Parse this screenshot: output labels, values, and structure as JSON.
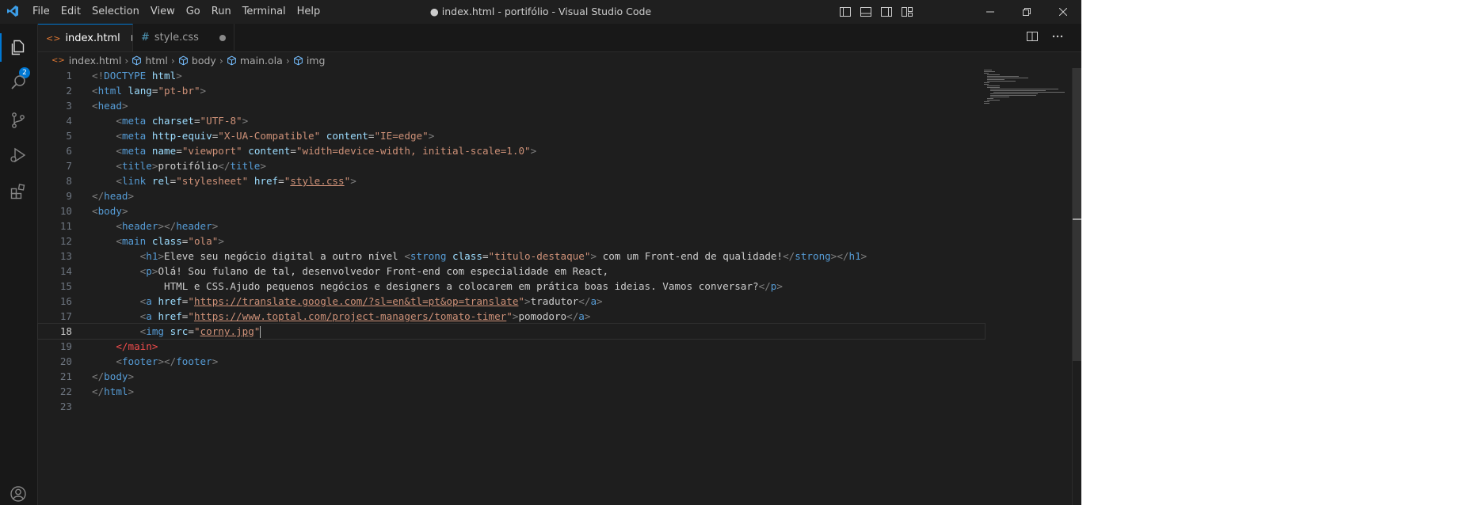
{
  "window": {
    "title": "● index.html - portifólio - Visual Studio Code"
  },
  "menu": [
    "File",
    "Edit",
    "Selection",
    "View",
    "Go",
    "Run",
    "Terminal",
    "Help"
  ],
  "activity": {
    "explorer_badge": "2"
  },
  "tabs": [
    {
      "label": "index.html",
      "icon": "html-file-icon",
      "modified": true
    },
    {
      "label": "style.css",
      "icon": "css-file-icon",
      "icon_glyph": "#",
      "modified": true
    }
  ],
  "breadcrumb": [
    "index.html",
    "html",
    "body",
    "main.ola",
    "img"
  ],
  "editor": {
    "current_line": 18,
    "lines": [
      {
        "n": "1",
        "tokens": [
          [
            "br",
            "<!"
          ],
          [
            "tag",
            "DOCTYPE"
          ],
          [
            "txt",
            " "
          ],
          [
            "attr",
            "html"
          ],
          [
            "br",
            ">"
          ]
        ]
      },
      {
        "n": "2",
        "tokens": [
          [
            "br",
            "<"
          ],
          [
            "tag",
            "html"
          ],
          [
            "txt",
            " "
          ],
          [
            "attr",
            "lang"
          ],
          [
            "txt",
            "="
          ],
          [
            "str",
            "\"pt-br\""
          ],
          [
            "br",
            ">"
          ]
        ]
      },
      {
        "n": "3",
        "tokens": [
          [
            "br",
            "<"
          ],
          [
            "tag",
            "head"
          ],
          [
            "br",
            ">"
          ]
        ]
      },
      {
        "n": "4",
        "tokens": [
          [
            "txt",
            "    "
          ],
          [
            "br",
            "<"
          ],
          [
            "tag",
            "meta"
          ],
          [
            "txt",
            " "
          ],
          [
            "attr",
            "charset"
          ],
          [
            "txt",
            "="
          ],
          [
            "str",
            "\"UTF-8\""
          ],
          [
            "br",
            ">"
          ]
        ]
      },
      {
        "n": "5",
        "tokens": [
          [
            "txt",
            "    "
          ],
          [
            "br",
            "<"
          ],
          [
            "tag",
            "meta"
          ],
          [
            "txt",
            " "
          ],
          [
            "attr",
            "http-equiv"
          ],
          [
            "txt",
            "="
          ],
          [
            "str",
            "\"X-UA-Compatible\""
          ],
          [
            "txt",
            " "
          ],
          [
            "attr",
            "content"
          ],
          [
            "txt",
            "="
          ],
          [
            "str",
            "\"IE=edge\""
          ],
          [
            "br",
            ">"
          ]
        ]
      },
      {
        "n": "6",
        "tokens": [
          [
            "txt",
            "    "
          ],
          [
            "br",
            "<"
          ],
          [
            "tag",
            "meta"
          ],
          [
            "txt",
            " "
          ],
          [
            "attr",
            "name"
          ],
          [
            "txt",
            "="
          ],
          [
            "str",
            "\"viewport\""
          ],
          [
            "txt",
            " "
          ],
          [
            "attr",
            "content"
          ],
          [
            "txt",
            "="
          ],
          [
            "str",
            "\"width=device-width, initial-scale=1.0\""
          ],
          [
            "br",
            ">"
          ]
        ]
      },
      {
        "n": "7",
        "tokens": [
          [
            "txt",
            "    "
          ],
          [
            "br",
            "<"
          ],
          [
            "tag",
            "title"
          ],
          [
            "br",
            ">"
          ],
          [
            "txt",
            "protifólio"
          ],
          [
            "br",
            "</"
          ],
          [
            "tag",
            "title"
          ],
          [
            "br",
            ">"
          ]
        ]
      },
      {
        "n": "8",
        "tokens": [
          [
            "txt",
            "    "
          ],
          [
            "br",
            "<"
          ],
          [
            "tag",
            "link"
          ],
          [
            "txt",
            " "
          ],
          [
            "attr",
            "rel"
          ],
          [
            "txt",
            "="
          ],
          [
            "str",
            "\"stylesheet\""
          ],
          [
            "txt",
            " "
          ],
          [
            "attr",
            "href"
          ],
          [
            "txt",
            "="
          ],
          [
            "str",
            "\""
          ],
          [
            "stru",
            "style.css"
          ],
          [
            "str",
            "\""
          ],
          [
            "br",
            ">"
          ]
        ]
      },
      {
        "n": "9",
        "tokens": [
          [
            "br",
            "</"
          ],
          [
            "tag",
            "head"
          ],
          [
            "br",
            ">"
          ]
        ]
      },
      {
        "n": "10",
        "tokens": [
          [
            "br",
            "<"
          ],
          [
            "tag",
            "body"
          ],
          [
            "br",
            ">"
          ]
        ]
      },
      {
        "n": "11",
        "tokens": [
          [
            "txt",
            "    "
          ],
          [
            "br",
            "<"
          ],
          [
            "tag",
            "header"
          ],
          [
            "br",
            "></"
          ],
          [
            "tag",
            "header"
          ],
          [
            "br",
            ">"
          ]
        ]
      },
      {
        "n": "12",
        "tokens": [
          [
            "txt",
            "    "
          ],
          [
            "br",
            "<"
          ],
          [
            "tag",
            "main"
          ],
          [
            "txt",
            " "
          ],
          [
            "attr",
            "class"
          ],
          [
            "txt",
            "="
          ],
          [
            "str",
            "\"ola\""
          ],
          [
            "br",
            ">"
          ]
        ]
      },
      {
        "n": "13",
        "tokens": [
          [
            "txt",
            "        "
          ],
          [
            "br",
            "<"
          ],
          [
            "tag",
            "h1"
          ],
          [
            "br",
            ">"
          ],
          [
            "txt",
            "Eleve seu negócio digital a outro nível "
          ],
          [
            "br",
            "<"
          ],
          [
            "tag",
            "strong"
          ],
          [
            "txt",
            " "
          ],
          [
            "attr",
            "class"
          ],
          [
            "txt",
            "="
          ],
          [
            "str",
            "\"titulo-destaque\""
          ],
          [
            "br",
            ">"
          ],
          [
            "txt",
            " com um Front-end de qualidade!"
          ],
          [
            "br",
            "</"
          ],
          [
            "tag",
            "strong"
          ],
          [
            "br",
            "></"
          ],
          [
            "tag",
            "h1"
          ],
          [
            "br",
            ">"
          ]
        ]
      },
      {
        "n": "14",
        "tokens": [
          [
            "txt",
            "        "
          ],
          [
            "br",
            "<"
          ],
          [
            "tag",
            "p"
          ],
          [
            "br",
            ">"
          ],
          [
            "txt",
            "Olá! Sou fulano de tal, desenvolvedor Front-end com especialidade em React,"
          ]
        ]
      },
      {
        "n": "15",
        "tokens": [
          [
            "txt",
            "            HTML e CSS.Ajudo pequenos negócios e designers a colocarem em prática boas ideias. Vamos conversar?"
          ],
          [
            "br",
            "</"
          ],
          [
            "tag",
            "p"
          ],
          [
            "br",
            ">"
          ]
        ]
      },
      {
        "n": "16",
        "tokens": [
          [
            "txt",
            "        "
          ],
          [
            "br",
            "<"
          ],
          [
            "tag",
            "a"
          ],
          [
            "txt",
            " "
          ],
          [
            "attr",
            "href"
          ],
          [
            "txt",
            "="
          ],
          [
            "str",
            "\""
          ],
          [
            "stru",
            "https://translate.google.com/?sl=en&tl=pt&op=translate"
          ],
          [
            "str",
            "\""
          ],
          [
            "br",
            ">"
          ],
          [
            "txt",
            "tradutor"
          ],
          [
            "br",
            "</"
          ],
          [
            "tag",
            "a"
          ],
          [
            "br",
            ">"
          ]
        ]
      },
      {
        "n": "17",
        "tokens": [
          [
            "txt",
            "        "
          ],
          [
            "br",
            "<"
          ],
          [
            "tag",
            "a"
          ],
          [
            "txt",
            " "
          ],
          [
            "attr",
            "href"
          ],
          [
            "txt",
            "="
          ],
          [
            "str",
            "\""
          ],
          [
            "stru",
            "https://www.toptal.com/project-managers/tomato-timer"
          ],
          [
            "str",
            "\""
          ],
          [
            "br",
            ">"
          ],
          [
            "txt",
            "pomodoro"
          ],
          [
            "br",
            "</"
          ],
          [
            "tag",
            "a"
          ],
          [
            "br",
            ">"
          ]
        ]
      },
      {
        "n": "18",
        "tokens": [
          [
            "txt",
            "        "
          ],
          [
            "br",
            "<"
          ],
          [
            "tag",
            "img"
          ],
          [
            "txt",
            " "
          ],
          [
            "attr",
            "src"
          ],
          [
            "txt",
            "="
          ],
          [
            "str",
            "\""
          ],
          [
            "stru",
            "corny.jpg"
          ],
          [
            "str",
            "\""
          ],
          [
            "cursor",
            ""
          ]
        ]
      },
      {
        "n": "19",
        "tokens": [
          [
            "txt",
            "    "
          ],
          [
            "red",
            "</main>"
          ]
        ]
      },
      {
        "n": "20",
        "tokens": [
          [
            "txt",
            "    "
          ],
          [
            "br",
            "<"
          ],
          [
            "tag",
            "footer"
          ],
          [
            "br",
            "></"
          ],
          [
            "tag",
            "footer"
          ],
          [
            "br",
            ">"
          ]
        ]
      },
      {
        "n": "21",
        "tokens": [
          [
            "br",
            "</"
          ],
          [
            "tag",
            "body"
          ],
          [
            "br",
            ">"
          ]
        ]
      },
      {
        "n": "22",
        "tokens": [
          [
            "br",
            "</"
          ],
          [
            "tag",
            "html"
          ],
          [
            "br",
            ">"
          ]
        ]
      },
      {
        "n": "23",
        "tokens": []
      }
    ]
  },
  "colors": {
    "accent": "#0078d4",
    "editor_bg": "#1e1e1e",
    "tag": "#569cd6",
    "attribute": "#9cdcfe",
    "string": "#ce9178",
    "error": "#f14c4c"
  }
}
